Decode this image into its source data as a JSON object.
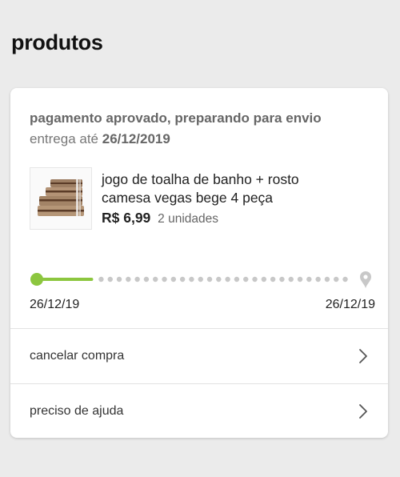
{
  "section": {
    "title": "produtos"
  },
  "order": {
    "status": "pagamento aprovado, preparando para envio",
    "delivery_prefix": "entrega até",
    "delivery_date": "26/12/2019"
  },
  "product": {
    "name": "jogo de toalha de banho + rosto camesa vegas bege 4 peça",
    "price": "R$ 6,99",
    "quantity": "2 unidades"
  },
  "tracking": {
    "start_date": "26/12/19",
    "end_date": "26/12/19",
    "progress_fraction": 0.25,
    "colors": {
      "active": "#8cc63f",
      "inactive": "#c8c8c8"
    }
  },
  "actions": {
    "cancel_label": "cancelar compra",
    "help_label": "preciso de ajuda"
  },
  "icons": {
    "thumbnail": "towel-product-image",
    "destination": "location-pin-icon",
    "chevron": "chevron-right-icon"
  }
}
